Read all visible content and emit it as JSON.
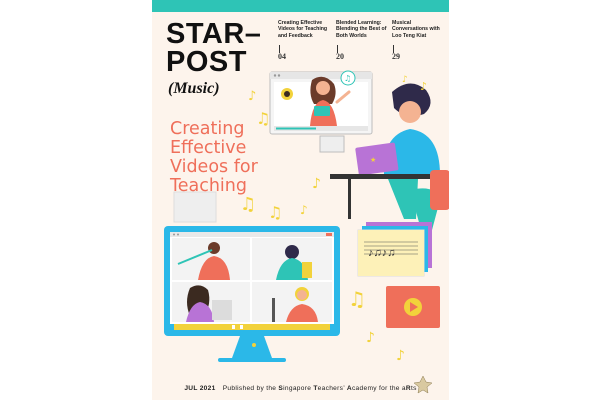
{
  "masthead": {
    "line1": "STAR–",
    "line2": "POST",
    "subtitle": "(Music)"
  },
  "toc": [
    {
      "title": "Creating Effective Videos for Teaching and Feedback",
      "page": "04"
    },
    {
      "title": "Blended Learning: Blending the Best of Both Worlds",
      "page": "20"
    },
    {
      "title": "Musical Conversations with Loo Teng Kiat",
      "page": "29"
    }
  ],
  "headline": "Creating Effective Videos for Teaching",
  "footer": {
    "date": "JUL 2021",
    "text_before": "Published by the",
    "s": "S",
    "ingapore": "ingapore",
    "t": "T",
    "eachers": "eachers’",
    "a": "A",
    "cademy": "cademy for the a",
    "rts": "R",
    "ts": "ts"
  },
  "colors": {
    "accent_teal": "#2ec4b6",
    "headline_coral": "#ef6f5a",
    "monitor_blue": "#29b6e8",
    "note_yellow": "#f2d23b"
  }
}
